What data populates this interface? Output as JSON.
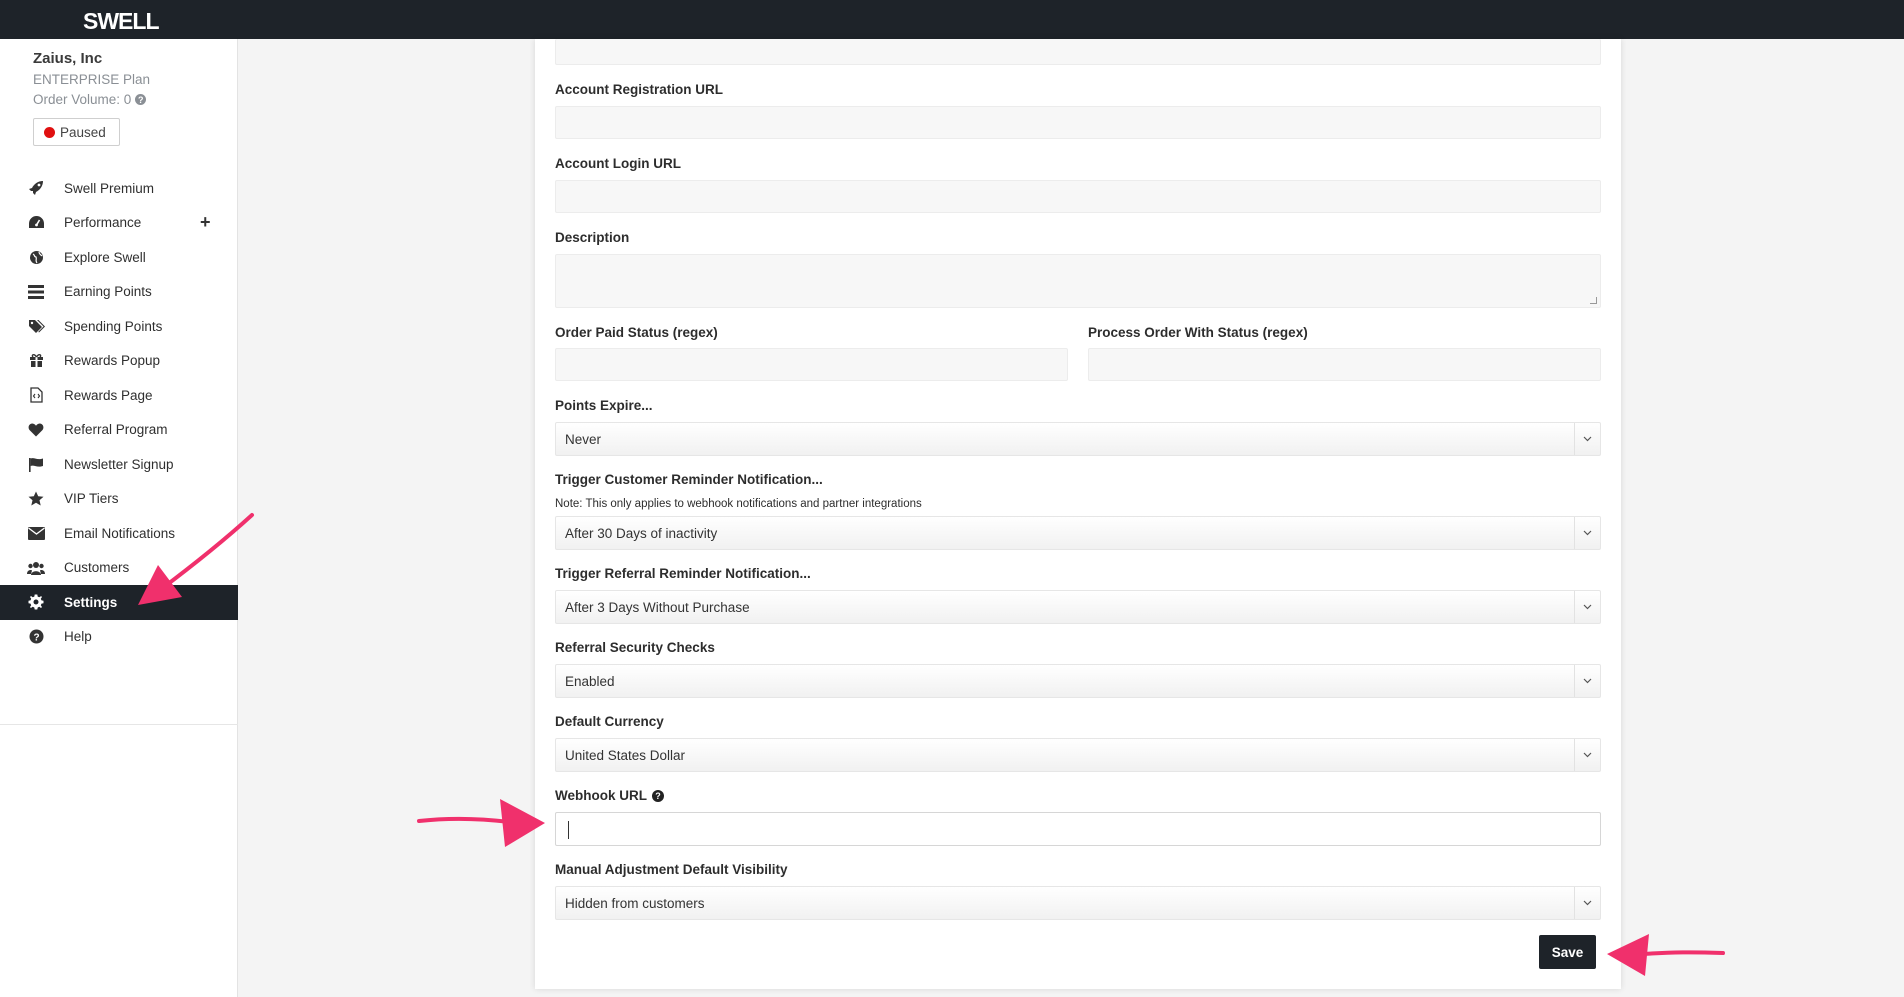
{
  "app": {
    "logo": "SWELL"
  },
  "account": {
    "name": "Zaius, Inc",
    "plan": "ENTERPRISE Plan",
    "order_volume": "Order Volume: 0",
    "status": "Paused"
  },
  "sidebar": {
    "items": [
      {
        "label": "Swell Premium",
        "icon": "rocket-icon"
      },
      {
        "label": "Performance",
        "icon": "dashboard-icon"
      },
      {
        "label": "Explore Swell",
        "icon": "globe-icon"
      },
      {
        "label": "Earning Points",
        "icon": "list-icon"
      },
      {
        "label": "Spending Points",
        "icon": "tags-icon"
      },
      {
        "label": "Rewards Popup",
        "icon": "gift-icon"
      },
      {
        "label": "Rewards Page",
        "icon": "code-file-icon"
      },
      {
        "label": "Referral Program",
        "icon": "heart-icon"
      },
      {
        "label": "Newsletter Signup",
        "icon": "flag-icon"
      },
      {
        "label": "VIP Tiers",
        "icon": "star-icon"
      },
      {
        "label": "Email Notifications",
        "icon": "envelope-icon"
      },
      {
        "label": "Customers",
        "icon": "users-icon"
      },
      {
        "label": "Settings",
        "icon": "gear-icon"
      },
      {
        "label": "Help",
        "icon": "question-icon"
      }
    ],
    "active": "Settings"
  },
  "form": {
    "account_registration_url": {
      "label": "Account Registration URL",
      "value": ""
    },
    "account_login_url": {
      "label": "Account Login URL",
      "value": ""
    },
    "description": {
      "label": "Description",
      "value": ""
    },
    "order_paid_status": {
      "label": "Order Paid Status (regex)",
      "value": ""
    },
    "process_order_status": {
      "label": "Process Order With Status (regex)",
      "value": ""
    },
    "points_expire": {
      "label": "Points Expire...",
      "value": "Never"
    },
    "customer_reminder": {
      "label": "Trigger Customer Reminder Notification...",
      "note": "Note: This only applies to webhook notifications and partner integrations",
      "value": "After 30 Days of inactivity"
    },
    "referral_reminder": {
      "label": "Trigger Referral Reminder Notification...",
      "value": "After 3 Days Without Purchase"
    },
    "referral_security": {
      "label": "Referral Security Checks",
      "value": "Enabled"
    },
    "default_currency": {
      "label": "Default Currency",
      "value": "United States Dollar"
    },
    "webhook_url": {
      "label": "Webhook URL",
      "value": ""
    },
    "manual_adjustment": {
      "label": "Manual Adjustment Default Visibility",
      "value": "Hidden from customers"
    },
    "save_label": "Save"
  },
  "colors": {
    "accent_dark": "#1e2329",
    "annotation_pink": "#f0306c",
    "paused_red": "#e01010"
  }
}
